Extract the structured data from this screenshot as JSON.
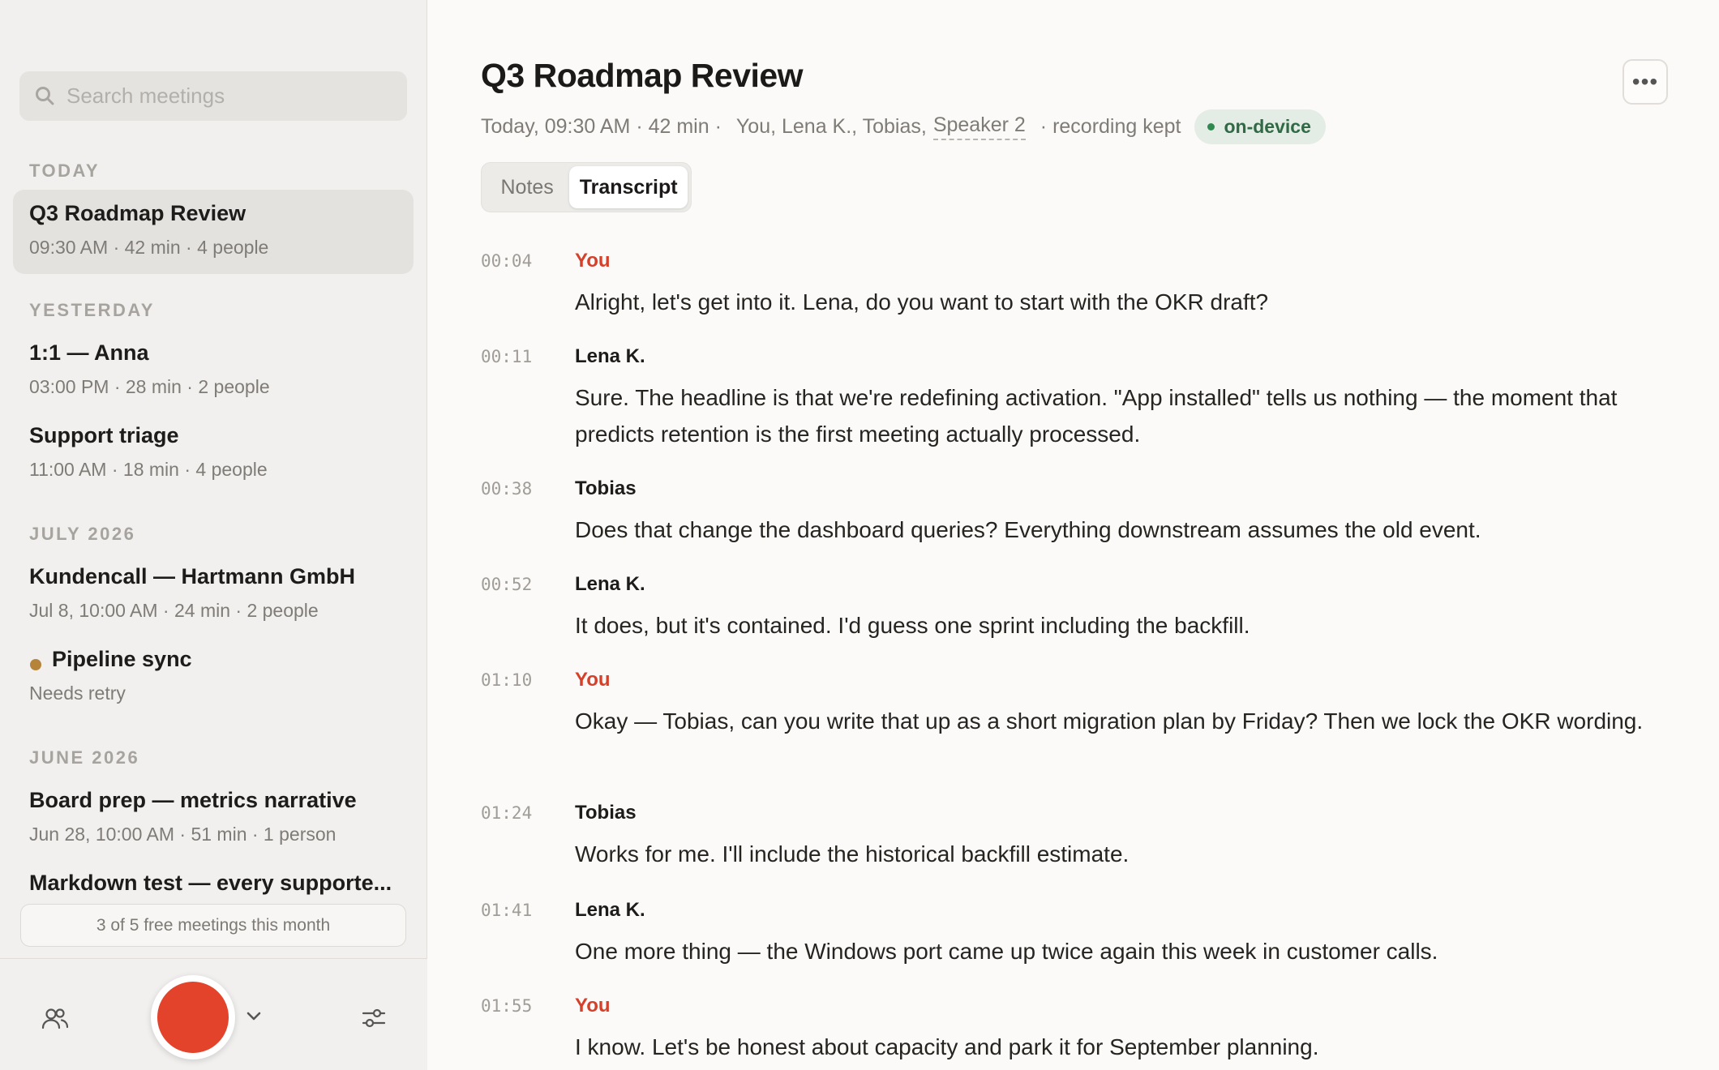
{
  "sidebar": {
    "search": {
      "placeholder": "Search meetings",
      "icon": "search-icon"
    },
    "sections": [
      {
        "heading": "TODAY",
        "items": [
          {
            "title": "Q3 Roadmap Review",
            "subtitle": "09:30 AM · 42 min · 4 people",
            "active": true
          }
        ]
      },
      {
        "heading": "YESTERDAY",
        "items": [
          {
            "title": "1:1 — Anna",
            "subtitle": "03:00 PM · 28 min · 2 people"
          },
          {
            "title": "Support triage",
            "subtitle": "11:00 AM · 18 min · 4 people"
          }
        ]
      },
      {
        "heading": "JULY 2026",
        "items": [
          {
            "title": "Kundencall — Hartmann GmbH",
            "subtitle": "Jul 8, 10:00 AM · 24 min · 2 people"
          },
          {
            "title": "Pipeline sync",
            "subtitle": "Needs retry",
            "status_color": "#b5843a"
          }
        ]
      },
      {
        "heading": "JUNE 2026",
        "items": [
          {
            "title": "Board prep — metrics narrative",
            "subtitle": "Jun 28, 10:00 AM · 51 min · 1 person"
          },
          {
            "title": "Markdown test — every supporte...",
            "subtitle": ""
          }
        ]
      }
    ],
    "quota": "3 of 5 free meetings this month",
    "bottom": {
      "people_icon": "people-icon",
      "record_color": "#e2432a",
      "settings_icon": "sliders-icon"
    }
  },
  "main": {
    "title": "Q3 Roadmap Review",
    "meta": {
      "datetime": "Today, 09:30 AM · 42 min ·",
      "participants": "You, Lena K., Tobias,",
      "unresolved_speaker": "Speaker 2",
      "recording": "· recording kept",
      "badge": "on-device"
    },
    "more_label": "•••",
    "tabs": [
      {
        "label": "Notes"
      },
      {
        "label": "Transcript",
        "selected": true
      }
    ],
    "transcript": [
      {
        "time": "00:04",
        "speaker": "You",
        "text": "Alright, let's get into it. Lena, do you want to start with the OKR draft?"
      },
      {
        "time": "00:11",
        "speaker": "Lena K.",
        "text": "Sure. The headline is that we're redefining activation. \"App installed\" tells us nothing — the moment that predicts retention is the first meeting actually processed."
      },
      {
        "time": "00:38",
        "speaker": "Tobias",
        "text": "Does that change the dashboard queries? Everything downstream assumes the old event."
      },
      {
        "time": "00:52",
        "speaker": "Lena K.",
        "text": "It does, but it's contained. I'd guess one sprint including the backfill."
      },
      {
        "time": "01:10",
        "speaker": "You",
        "text": "Okay — Tobias, can you write that up as a short migration plan by Friday? Then we lock the OKR wording."
      },
      {
        "time": "01:24",
        "speaker": "Tobias",
        "text": "Works for me. I'll include the historical backfill estimate."
      },
      {
        "time": "01:41",
        "speaker": "Lena K.",
        "text": "One more thing — the Windows port came up twice again this week in customer calls."
      },
      {
        "time": "01:55",
        "speaker": "You",
        "text": "I know. Let's be honest about capacity and park it for September planning."
      }
    ],
    "colors": {
      "you": "#d4402a",
      "badge_bg": "#e3ece5",
      "badge_fg": "#2f6a44"
    }
  }
}
